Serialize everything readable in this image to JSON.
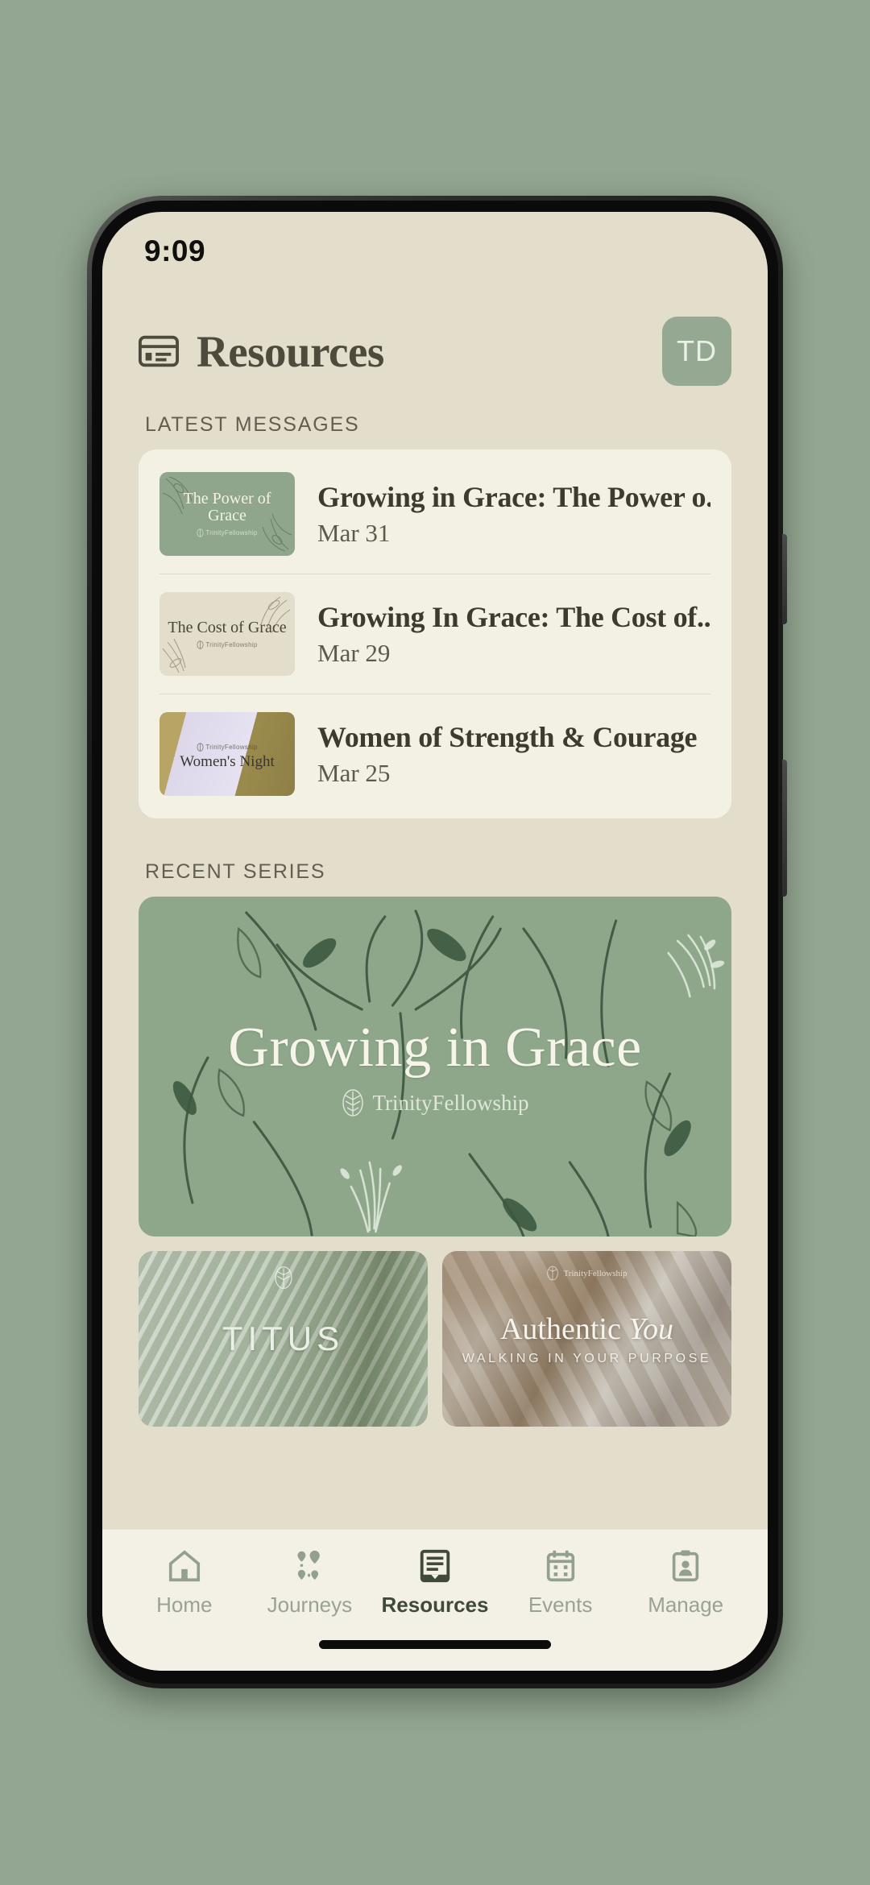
{
  "background_color": "#93a691",
  "status_bar": {
    "time": "9:09"
  },
  "header": {
    "icon": "article-card-icon",
    "title": "Resources",
    "avatar_initials": "TD",
    "avatar_color": "#95a892"
  },
  "sections": {
    "latest_messages_label": "LATEST MESSAGES",
    "recent_series_label": "RECENT SERIES"
  },
  "latest_messages": [
    {
      "thumb_title": "The Power of Grace",
      "thumb_brand": "TrinityFellowship",
      "thumb_style": "green",
      "title": "Growing in Grace: The Power o...",
      "date": "Mar 31"
    },
    {
      "thumb_title": "The Cost of Grace",
      "thumb_brand": "TrinityFellowship",
      "thumb_style": "cream",
      "title": "Growing In Grace: The Cost of...",
      "date": "Mar 29"
    },
    {
      "thumb_title": "Women's Night",
      "thumb_brand": "TrinityFellowship",
      "thumb_style": "purple",
      "title": "Women of Strength & Courage",
      "date": "Mar 25"
    }
  ],
  "recent_series": {
    "hero": {
      "title": "Growing in Grace",
      "brand": "TrinityFellowship",
      "background_color": "#8ea78b"
    },
    "cards": [
      {
        "title": "TITUS",
        "subtitle": "",
        "brand": ""
      },
      {
        "title_plain": "Authentic ",
        "title_italic": "You",
        "subtitle": "WALKING IN YOUR PURPOSE",
        "brand": "TrinityFellowship"
      }
    ]
  },
  "bottom_nav": {
    "items": [
      {
        "label": "Home",
        "icon": "home-icon",
        "active": false
      },
      {
        "label": "Journeys",
        "icon": "journeys-icon",
        "active": false
      },
      {
        "label": "Resources",
        "icon": "resources-icon",
        "active": true
      },
      {
        "label": "Events",
        "icon": "calendar-icon",
        "active": false
      },
      {
        "label": "Manage",
        "icon": "clipboard-person-icon",
        "active": false
      }
    ]
  }
}
